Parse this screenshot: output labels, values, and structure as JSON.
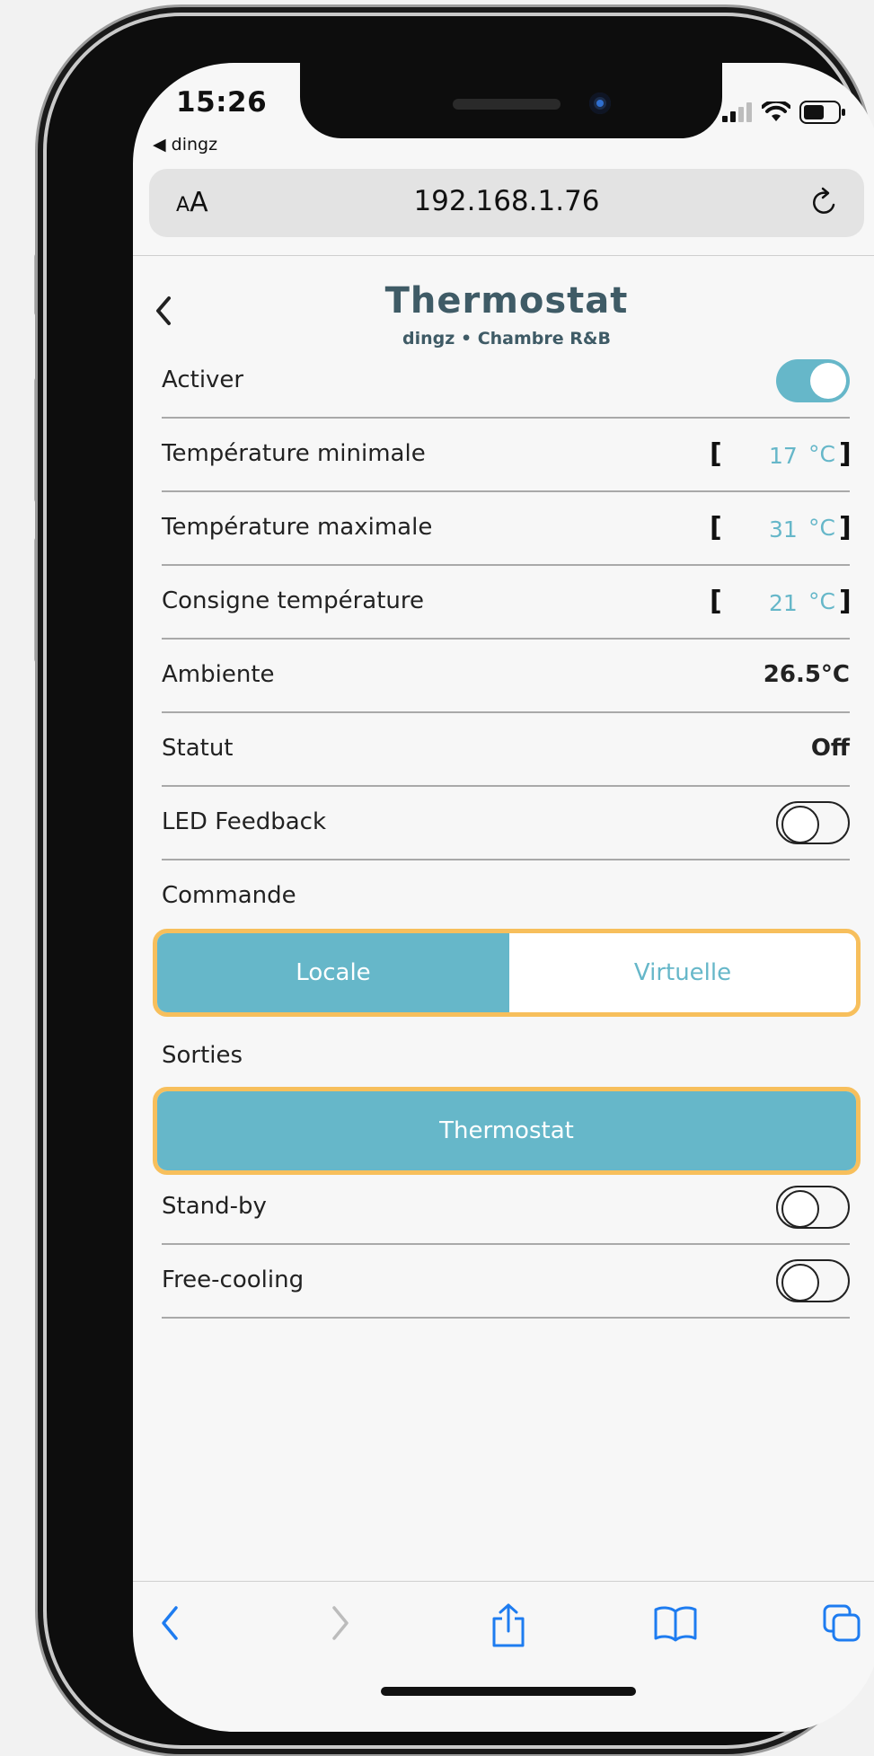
{
  "status_bar": {
    "time": "15:26",
    "back_app": "◀ dingz"
  },
  "browser": {
    "text_size_small": "A",
    "text_size_large": "A",
    "url": "192.168.1.76"
  },
  "header": {
    "title": "Thermostat",
    "subtitle": "dingz • Chambre R&B"
  },
  "rows": {
    "activer": {
      "label": "Activer",
      "on": true
    },
    "temp_min": {
      "label": "Température minimale",
      "bracket_open": "[",
      "value": "17",
      "unit": "°C",
      "bracket_close": "]"
    },
    "temp_max": {
      "label": "Température maximale",
      "bracket_open": "[",
      "value": "31",
      "unit": "°C",
      "bracket_close": "]"
    },
    "consigne": {
      "label": "Consigne température",
      "bracket_open": "[",
      "value": "21",
      "unit": "°C",
      "bracket_close": "]"
    },
    "ambiente": {
      "label": "Ambiente",
      "value": "26.5°C"
    },
    "statut": {
      "label": "Statut",
      "value": "Off"
    },
    "led_feedback": {
      "label": "LED Feedback",
      "on": false
    }
  },
  "commande": {
    "label": "Commande",
    "options": [
      "Locale",
      "Virtuelle"
    ],
    "selected": "Locale"
  },
  "sorties": {
    "label": "Sorties",
    "option": "Thermostat"
  },
  "extra_rows": {
    "standby": {
      "label": "Stand-by",
      "on": false
    },
    "free_cooling": {
      "label": "Free-cooling",
      "on": false
    }
  },
  "colors": {
    "accent": "#66b7c9",
    "title": "#3f5b66",
    "highlight": "#f7bf5c",
    "ios_blue": "#1e7cf0"
  },
  "toolbar_icons": [
    "back-icon",
    "forward-icon",
    "share-icon",
    "bookmarks-icon",
    "tabs-icon"
  ]
}
